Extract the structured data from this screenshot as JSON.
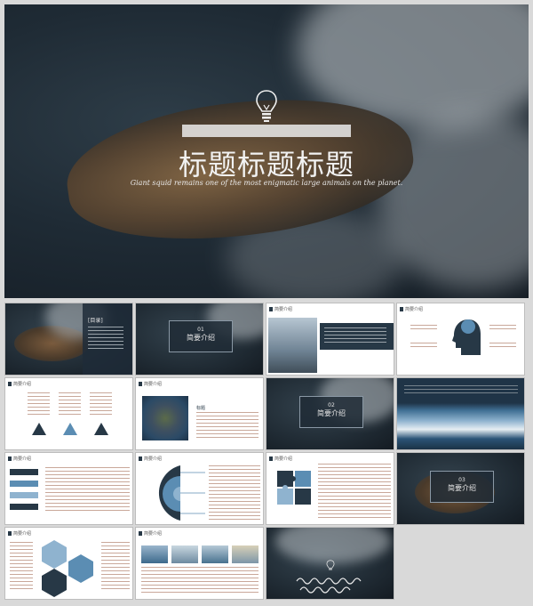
{
  "hero": {
    "title": "标题标题标题",
    "subtitle": "Giant squid remains one of the most enigmatic large animals on the planet."
  },
  "slides": {
    "s2": {
      "menu_title": "[目录]"
    },
    "s3": {
      "number": "01",
      "title": "简要介绍"
    },
    "s4": {
      "header": "简要介绍"
    },
    "s5": {
      "header": "简要介绍"
    },
    "s6": {
      "header": "简要介绍"
    },
    "s7": {
      "header": "简要介绍",
      "caption": "标题"
    },
    "s8": {
      "number": "02",
      "title": "简要介绍"
    },
    "s10": {
      "header": "简要介绍"
    },
    "s11": {
      "header": "简要介绍"
    },
    "s12": {
      "header": "简要介绍"
    },
    "s13": {
      "number": "03",
      "title": "简要介绍"
    },
    "s14": {
      "header": "简要介绍"
    },
    "s15": {
      "header": "简要介绍"
    }
  },
  "colors": {
    "navy": "#273846",
    "accent_blue": "#5b8db3",
    "accent_light": "#8fb3cf"
  }
}
